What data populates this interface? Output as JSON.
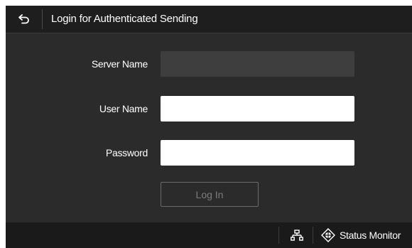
{
  "header": {
    "title": "Login for Authenticated Sending",
    "back_icon": "back-arrow-icon"
  },
  "form": {
    "server_name": {
      "label": "Server Name",
      "value": "",
      "enabled": false
    },
    "user_name": {
      "label": "User Name",
      "value": ""
    },
    "password": {
      "label": "Password",
      "value": ""
    },
    "login_button": {
      "label": "Log In",
      "enabled": false
    }
  },
  "footer": {
    "network_icon": "network-icon",
    "status_monitor_icon": "status-monitor-icon",
    "status_monitor_label": "Status Monitor"
  },
  "colors": {
    "background": "#2b2b2b",
    "header": "#1e1e1e",
    "footer": "#1a1a1a",
    "disabled_field": "#3e3e3e",
    "input_field": "#ffffff",
    "disabled_text": "#7c7c7c"
  }
}
